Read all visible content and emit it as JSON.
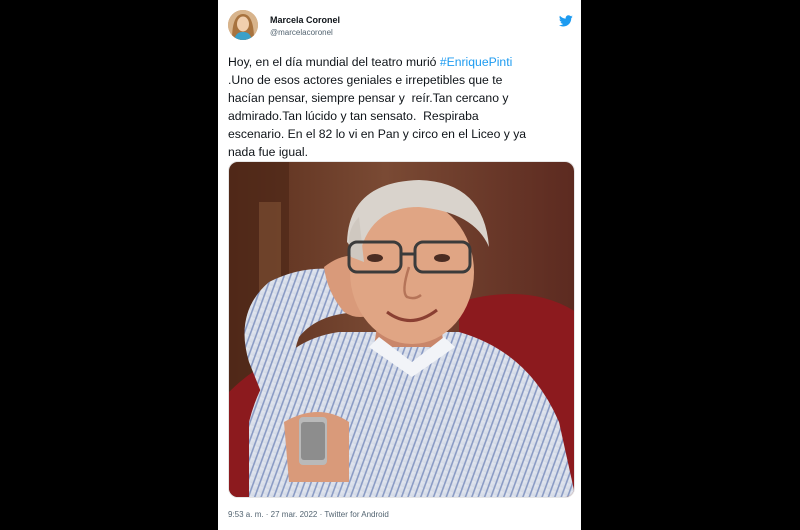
{
  "tweet": {
    "author_name": "Marcela Coronel",
    "author_handle": "@marcelacoronel",
    "text_before": "Hoy, en el día mundial del teatro murió ",
    "hashtag": "#EnriquePinti",
    "text_after": "\n.Uno de esos actores geniales e irrepetibles que te\nhacían pensar, siempre pensar y  reír.Tan cercano y\nadmirado.Tan lúcido y tan sensato.  Respiraba\nescenario. En el 82 lo vi en Pan y circo en el Liceo y ya\nnada fue igual.",
    "timestamp": "9:53 a. m. · 27 mar. 2022 · ",
    "source": "Twitter for Android"
  },
  "icons": {
    "platform_logo": "twitter-bird-icon"
  },
  "colors": {
    "link": "#1d9bf0",
    "text": "#0f1419",
    "secondary": "#536471",
    "page_background": "#000000"
  }
}
